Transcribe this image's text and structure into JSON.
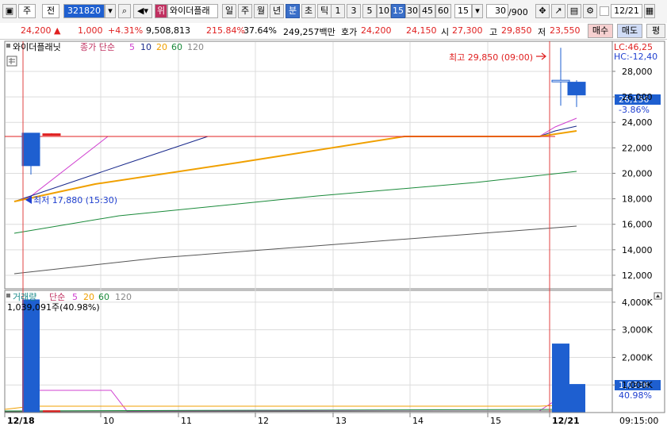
{
  "toolbar": {
    "market": "주",
    "type": "전",
    "code": "321820",
    "stock_badge": "위",
    "stock_name": "와이더플래",
    "periods": [
      "일",
      "주",
      "월",
      "년"
    ],
    "tick_units": [
      "분",
      "초",
      "틱"
    ],
    "active_unit": "분",
    "intervals": [
      "1",
      "3",
      "5",
      "10",
      "15",
      "30",
      "45",
      "60"
    ],
    "active_interval": "15",
    "interval_select": "15",
    "count": "30",
    "count_max": "/900",
    "date": "12/21"
  },
  "quote": {
    "price": "24,200",
    "arrow": "▲",
    "change": "1,000",
    "change_pct": "+4.31%",
    "volume": "9,508,813",
    "vol_ratio": "215.84%",
    "turnover": "37.64%",
    "amount": "249,257백만",
    "hoga_label": "호가",
    "ask": "24,200",
    "bid": "24,150",
    "open_label": "시",
    "open": "27,300",
    "high_label": "고",
    "high": "29,850",
    "low_label": "저",
    "low": "23,550",
    "buy_label": "매수",
    "sell_label": "매도",
    "eval_label": "평"
  },
  "price_panel": {
    "legend_name": "와이더플래닛",
    "legend_type": "종가 단순",
    "ma_labels": [
      "5",
      "10",
      "20",
      "60",
      "120"
    ],
    "ma_colors": [
      "#d040d0",
      "#1a2a8c",
      "#f0a000",
      "#1a8a3a",
      "#555555"
    ],
    "lc": "LC:46,25",
    "hc": "HC:-12,40",
    "high_note": "최고 29,850 (09:00)",
    "low_note": "최저 17,880 (15:30)",
    "current_price": "26,150",
    "current_pct": "-3.86%",
    "y_ticks": [
      "28,000",
      "26,000",
      "24,000",
      "22,000",
      "20,000",
      "18,000",
      "16,000",
      "14,000",
      "12,000"
    ]
  },
  "volume_panel": {
    "legend_name": "거래량",
    "legend_type": "단순",
    "ma_labels": [
      "5",
      "20",
      "60",
      "120"
    ],
    "ma_colors": [
      "#d040d0",
      "#f0a000",
      "#1a8a3a",
      "#555555"
    ],
    "volume_note": "1,039,091주(40.98%)",
    "current_volume": "1,033K",
    "current_pct": "40.98%",
    "y_ticks": [
      "4,000K",
      "3,000K",
      "2,000K",
      "1,000K"
    ]
  },
  "x_axis": {
    "labels": [
      "12/18",
      "10",
      "11",
      "12",
      "13",
      "14",
      "15",
      "12/21"
    ],
    "time": "09:15:00"
  },
  "chart_data": {
    "type": "candlestick",
    "candles": [
      {
        "o": 23150,
        "h": 23150,
        "l": 19900,
        "c": 20600
      },
      {
        "o": 23050,
        "h": 23150,
        "l": 23050,
        "c": 23100
      },
      {
        "o": 27300,
        "h": 29850,
        "l": 25300,
        "c": 27200
      },
      {
        "o": 27150,
        "h": 27300,
        "l": 25200,
        "c": 26150
      }
    ],
    "volumes": [
      4100,
      80,
      2500,
      1033
    ],
    "price_range": [
      11000,
      30300
    ],
    "volume_range": [
      0,
      4400
    ]
  }
}
